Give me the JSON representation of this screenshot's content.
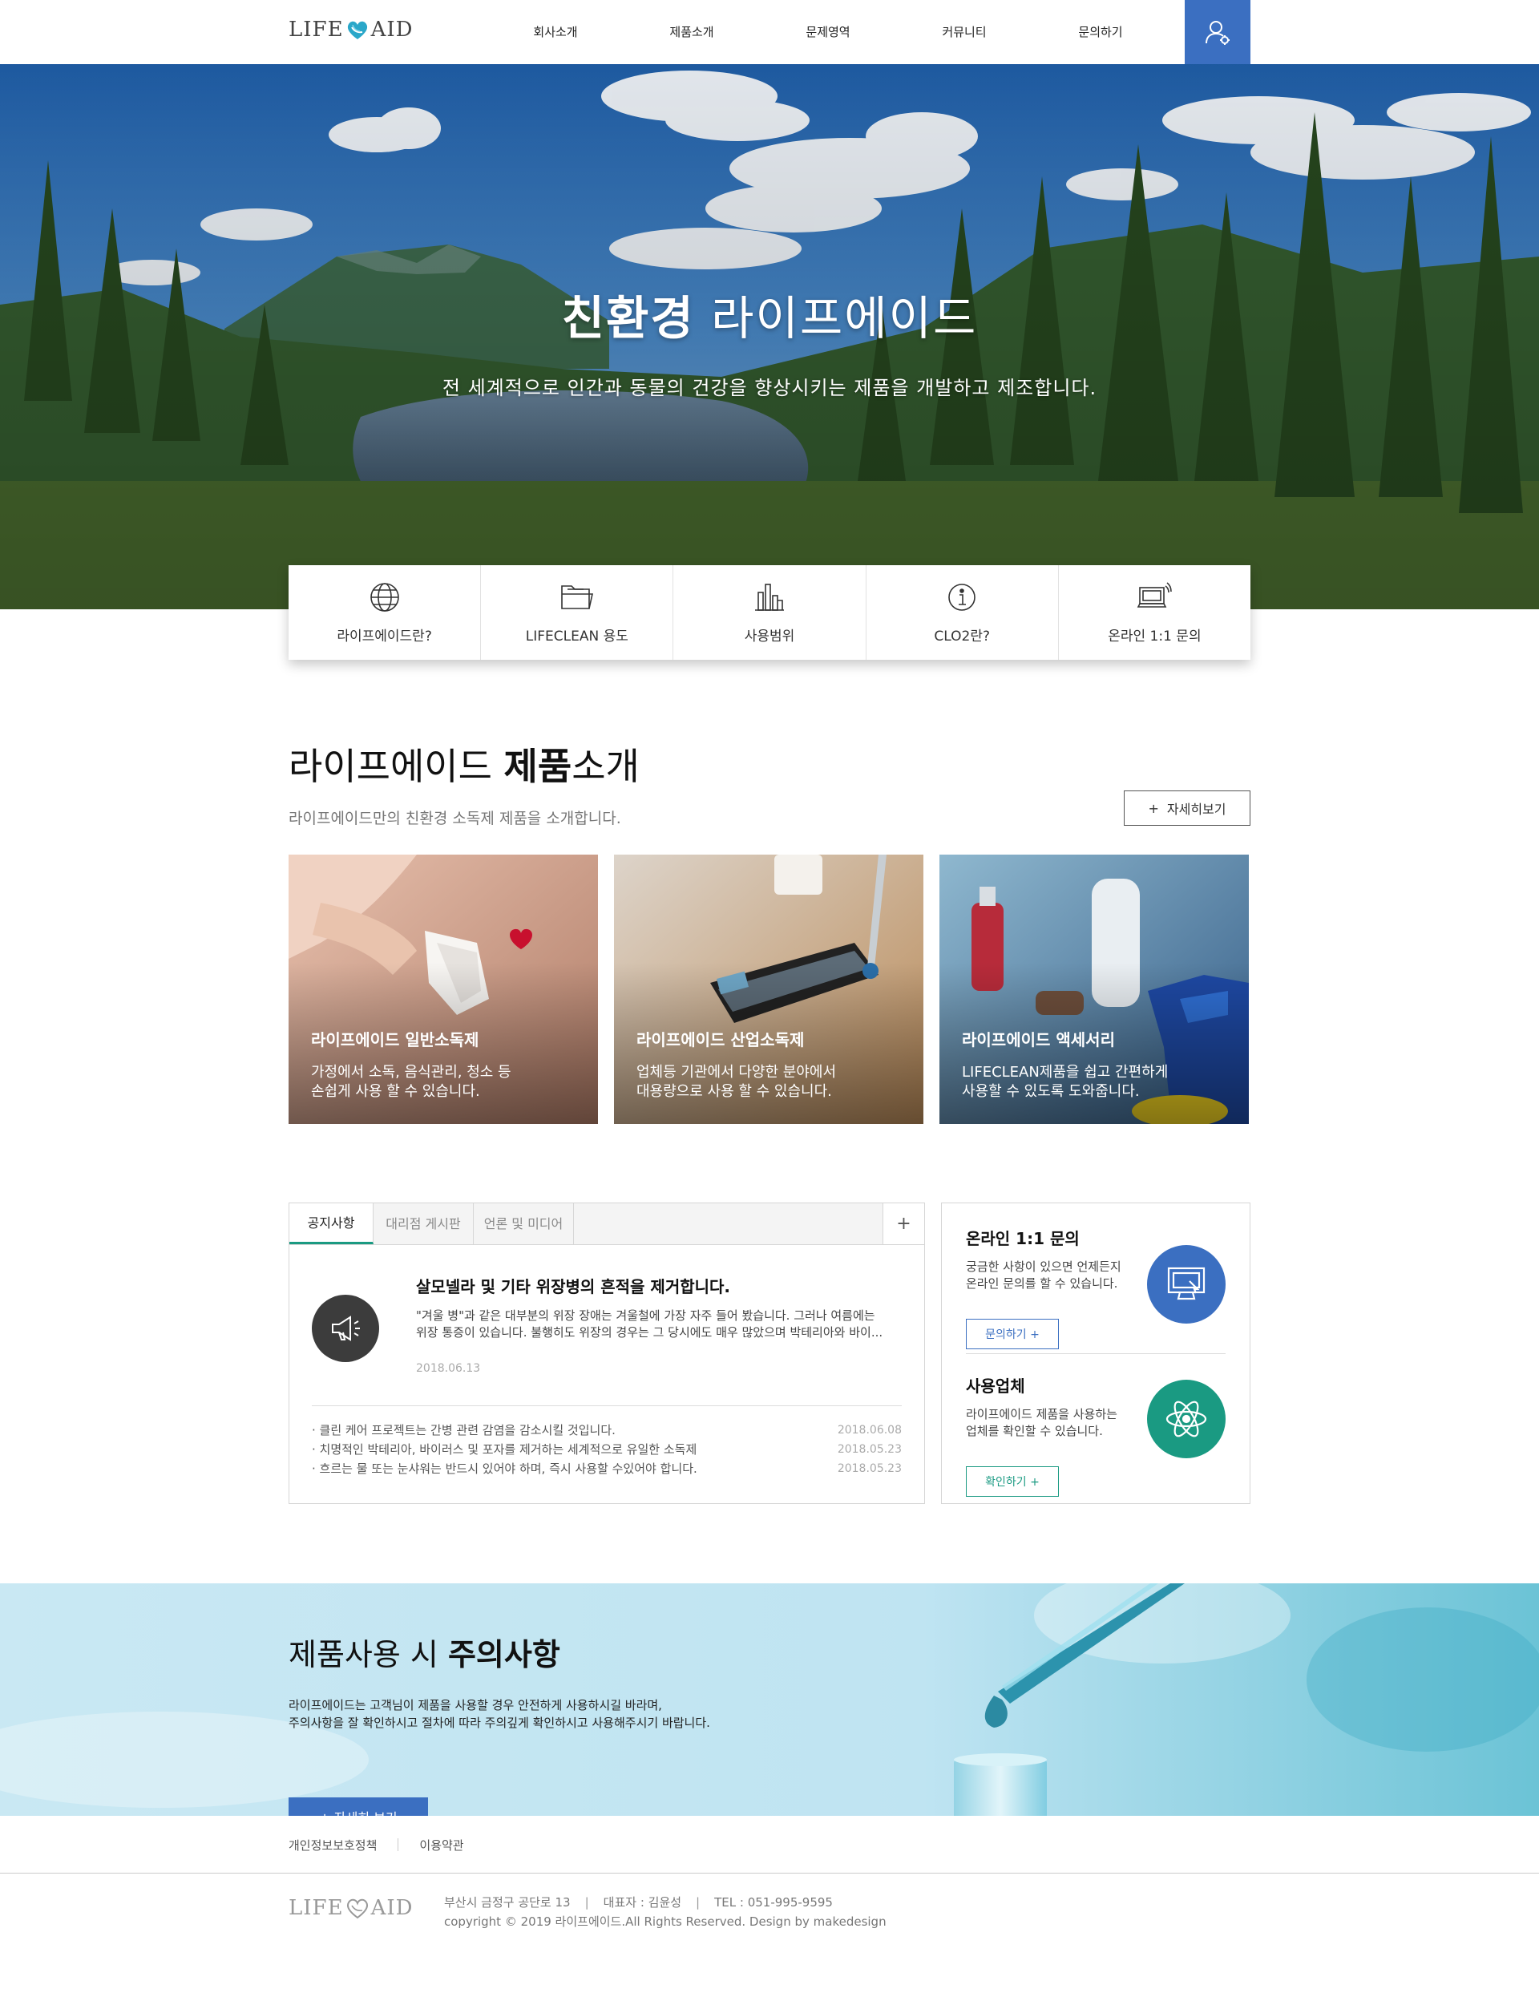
{
  "logo": {
    "left": "LIFE",
    "right": "AID"
  },
  "nav": [
    {
      "label": "회사소개"
    },
    {
      "label": "제품소개"
    },
    {
      "label": "문제영역"
    },
    {
      "label": "커뮤니티"
    },
    {
      "label": "문의하기"
    }
  ],
  "hero": {
    "title_bold": "친환경",
    "title_rest": " 라이프에이드",
    "subtitle": "전 세계적으로 인간과 동물의 건강을 향상시키는 제품을 개발하고 제조합니다."
  },
  "quick_menu": [
    {
      "label": "라이프에이드란?",
      "icon": "globe-icon"
    },
    {
      "label": "LIFECLEAN 용도",
      "icon": "folder-icon"
    },
    {
      "label": "사용범위",
      "icon": "bar-chart-icon"
    },
    {
      "label": "CLO2란?",
      "icon": "info-icon"
    },
    {
      "label": "온라인 1:1 문의",
      "icon": "computer-icon"
    }
  ],
  "products": {
    "title_light": "라이프에이드 ",
    "title_bold": "제품",
    "title_rest": "소개",
    "description": "라이프에이드만의 친환경 소독제 제품을 소개합니다.",
    "more_label": "자세히보기",
    "cards": [
      {
        "title": "라이프에이드 일반소독제",
        "desc": "가정에서 소독, 음식관리, 청소 등\n손쉽게 사용 할 수 있습니다."
      },
      {
        "title": "라이프에이드 산업소독제",
        "desc": "업체등 기관에서 다양한 분야에서\n대용량으로 사용 할 수 있습니다."
      },
      {
        "title": "라이프에이드 액세서리",
        "desc": "LIFECLEAN제품을 쉽고 간편하게\n사용할 수 있도록 도와줍니다."
      }
    ]
  },
  "board": {
    "tabs": [
      {
        "label": "공지사항",
        "active": true
      },
      {
        "label": "대리점 게시판",
        "active": false
      },
      {
        "label": "언론 및 미디어",
        "active": false
      }
    ],
    "plus": "+",
    "feature": {
      "title": "살모넬라 및 기타 위장병의 흔적을 제거합니다.",
      "text_line1": "\"겨울 병\"과 같은 대부분의 위장 장애는 겨울철에 가장 자주 들어 봤습니다. 그러나 여름에는",
      "text_line2": "위장 통증이 있습니다. 불행히도 위장의 경우는 그 당시에도 매우 많았으며 박테리아와 바이...",
      "date": "2018.06.13"
    },
    "items": [
      {
        "text": "· 클린 케어 프로젝트는 간병 관련 감염을 감소시킬 것입니다.",
        "date": "2018.06.08"
      },
      {
        "text": "· 치명적인 박테리아, 바이러스 및 포자를 제거하는 세계적으로 유일한 소독제",
        "date": "2018.05.23"
      },
      {
        "text": "· 흐르는 물 또는 눈샤워는 반드시 있어야 하며, 즉시 사용할 수있어야 합니다.",
        "date": "2018.05.23"
      }
    ]
  },
  "side": {
    "inquiry": {
      "title": "온라인 1:1 문의",
      "desc": "궁금한 사항이 있으면 언제든지\n온라인 문의를 할 수 있습니다.",
      "button": "문의하기 +"
    },
    "partners": {
      "title": "사용업체",
      "desc": "라이프에이드 제품을 사용하는\n업체를 확인할 수 있습니다.",
      "button": "확인하기 +"
    }
  },
  "caution": {
    "title_light": "제품사용 시 ",
    "title_bold": "주의사항",
    "body": "라이프에이드는 고객님이 제품을 사용할 경우 안전하게 사용하시길 바라며,\n주의사항을 잘 확인하시고 절차에 따라 주의깊게 확인하시고 사용해주시기 바랍니다.",
    "button": "+ 자세히 보기"
  },
  "footer": {
    "links": [
      {
        "label": "개인정보보호정책"
      },
      {
        "label": "이용약관"
      }
    ],
    "address": "부산시 금정구 공단로 13",
    "ceo": "대표자 : 김윤성",
    "tel": "TEL : 051-995-9595",
    "copyright": "copyright © 2019 라이프에이드.All Rights Reserved. Design by makedesign"
  },
  "colors": {
    "accent_blue": "#3b6fc1",
    "accent_green": "#1a9a82",
    "heart": "#2aa7c9"
  }
}
